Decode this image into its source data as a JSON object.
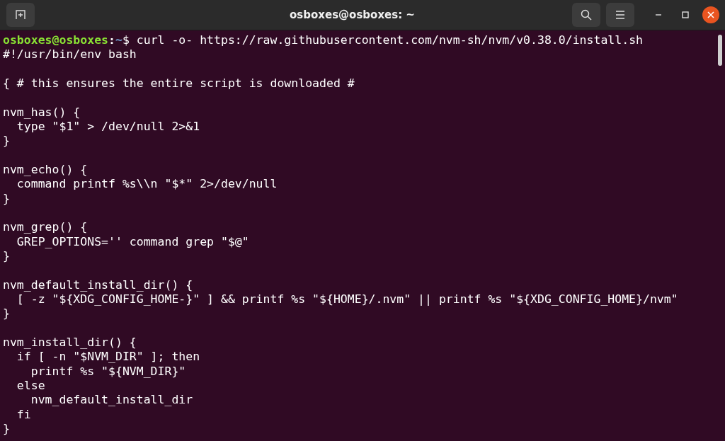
{
  "window": {
    "title": "osboxes@osboxes: ~"
  },
  "terminal": {
    "lines": [
      {
        "kind": "prompt",
        "user": "osboxes@osboxes",
        "separator": ":",
        "path": "~",
        "command": "$ curl -o- https://raw.githubusercontent.com/nvm-sh/nvm/v0.38.0/install.sh"
      },
      {
        "kind": "output",
        "text": "#!/usr/bin/env bash"
      },
      {
        "kind": "blank"
      },
      {
        "kind": "output",
        "text": "{ # this ensures the entire script is downloaded #"
      },
      {
        "kind": "blank"
      },
      {
        "kind": "output",
        "text": "nvm_has() {"
      },
      {
        "kind": "output",
        "text": "  type \"$1\" > /dev/null 2>&1"
      },
      {
        "kind": "output",
        "text": "}"
      },
      {
        "kind": "blank"
      },
      {
        "kind": "output",
        "text": "nvm_echo() {"
      },
      {
        "kind": "output",
        "text": "  command printf %s\\\\n \"$*\" 2>/dev/null"
      },
      {
        "kind": "output",
        "text": "}"
      },
      {
        "kind": "blank"
      },
      {
        "kind": "output",
        "text": "nvm_grep() {"
      },
      {
        "kind": "output",
        "text": "  GREP_OPTIONS='' command grep \"$@\""
      },
      {
        "kind": "output",
        "text": "}"
      },
      {
        "kind": "blank"
      },
      {
        "kind": "output",
        "text": "nvm_default_install_dir() {"
      },
      {
        "kind": "output",
        "text": "  [ -z \"${XDG_CONFIG_HOME-}\" ] && printf %s \"${HOME}/.nvm\" || printf %s \"${XDG_CONFIG_HOME}/nvm\""
      },
      {
        "kind": "output",
        "text": "}"
      },
      {
        "kind": "blank"
      },
      {
        "kind": "output",
        "text": "nvm_install_dir() {"
      },
      {
        "kind": "output",
        "text": "  if [ -n \"$NVM_DIR\" ]; then"
      },
      {
        "kind": "output",
        "text": "    printf %s \"${NVM_DIR}\""
      },
      {
        "kind": "output",
        "text": "  else"
      },
      {
        "kind": "output",
        "text": "    nvm_default_install_dir"
      },
      {
        "kind": "output",
        "text": "  fi"
      },
      {
        "kind": "output",
        "text": "}"
      }
    ]
  }
}
